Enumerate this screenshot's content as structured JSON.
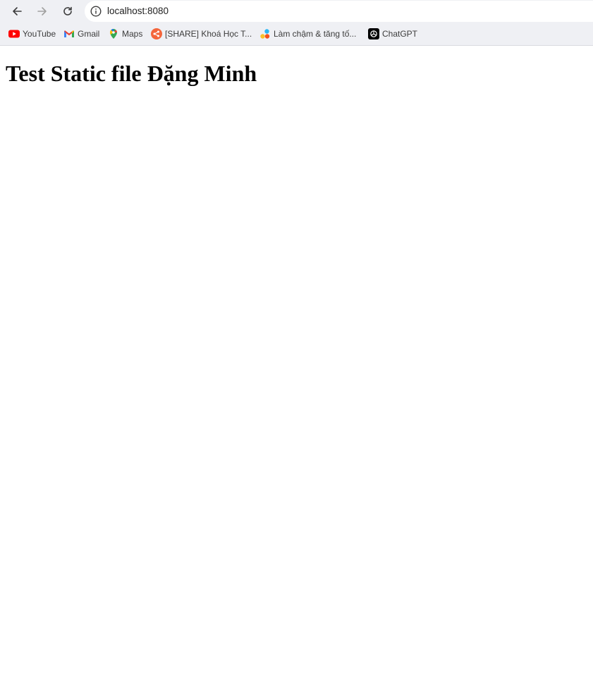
{
  "browser": {
    "url": "localhost:8080",
    "bookmarks": [
      {
        "label": "YouTube",
        "icon": "youtube-icon"
      },
      {
        "label": "Gmail",
        "icon": "gmail-icon"
      },
      {
        "label": "Maps",
        "icon": "maps-icon"
      },
      {
        "label": "[SHARE] Khoá Học T...",
        "icon": "share-icon"
      },
      {
        "label": "Làm chậm & tăng tố...",
        "icon": "app-dots-icon"
      },
      {
        "label": "ChatGPT",
        "icon": "chatgpt-icon"
      }
    ]
  },
  "page": {
    "heading": "Test Static file Đặng Minh"
  }
}
